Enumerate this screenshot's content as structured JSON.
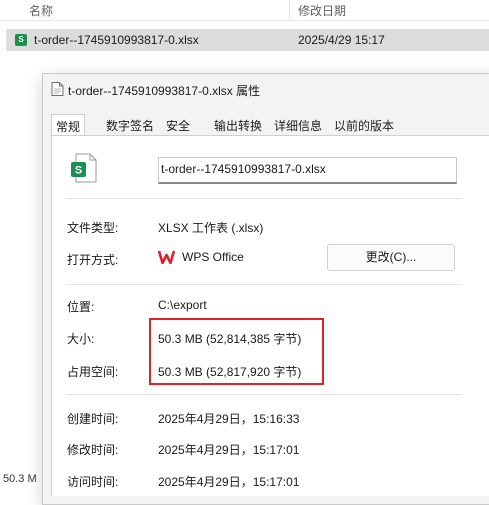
{
  "explorer": {
    "columns": {
      "name": "名称",
      "modified": "修改日期"
    },
    "file": {
      "name": "t-order--1745910993817-0.xlsx",
      "modified": "2025/4/29 15:17",
      "icon_letter": "S"
    },
    "status_size": "50.3 M"
  },
  "dialog": {
    "title": "t-order--1745910993817-0.xlsx 属性",
    "tabs": [
      "常规",
      "数字签名",
      "安全",
      "输出转换",
      "详细信息",
      "以前的版本"
    ],
    "filename": "t-order--1745910993817-0.xlsx",
    "file_type": {
      "label": "文件类型:",
      "value": "XLSX 工作表 (.xlsx)"
    },
    "open_with": {
      "label": "打开方式:",
      "app": "WPS Office",
      "button": "更改(C)..."
    },
    "location": {
      "label": "位置:",
      "value": "C:\\export"
    },
    "size": {
      "label": "大小:",
      "value": "50.3 MB (52,814,385 字节)"
    },
    "size_on_disk": {
      "label": "占用空间:",
      "value": "50.3 MB (52,817,920 字节)"
    },
    "created": {
      "label": "创建时间:",
      "value": "2025年4月29日，15:16:33"
    },
    "modified": {
      "label": "修改时间:",
      "value": "2025年4月29日，15:17:01"
    },
    "accessed": {
      "label": "访问时间:",
      "value": "2025年4月29日，15:17:01"
    }
  },
  "colors": {
    "highlight": "#e02323",
    "excel_green": "#1a8f4e",
    "wps_red": "#e0212a"
  }
}
